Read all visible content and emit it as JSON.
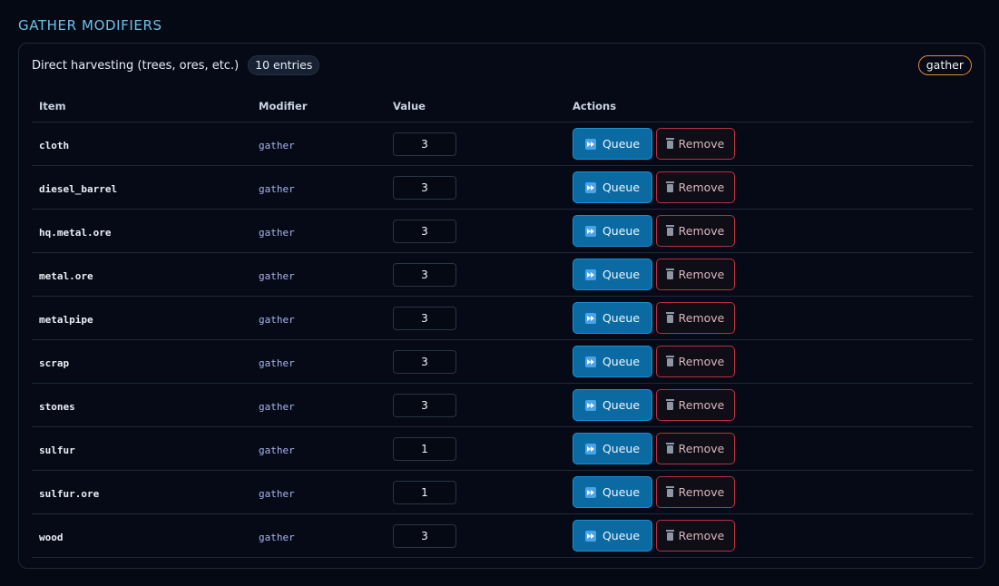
{
  "section_title": "GATHER MODIFIERS",
  "panel": {
    "description": "Direct harvesting (trees, ores, etc.)",
    "count_label": "10 entries",
    "tag": "gather"
  },
  "table": {
    "headers": {
      "item": "Item",
      "modifier": "Modifier",
      "value": "Value",
      "actions": "Actions"
    },
    "queue_label": "Queue",
    "remove_label": "Remove",
    "rows": [
      {
        "item": "cloth",
        "modifier": "gather",
        "value": "3"
      },
      {
        "item": "diesel_barrel",
        "modifier": "gather",
        "value": "3"
      },
      {
        "item": "hq.metal.ore",
        "modifier": "gather",
        "value": "3"
      },
      {
        "item": "metal.ore",
        "modifier": "gather",
        "value": "3"
      },
      {
        "item": "metalpipe",
        "modifier": "gather",
        "value": "3"
      },
      {
        "item": "scrap",
        "modifier": "gather",
        "value": "3"
      },
      {
        "item": "stones",
        "modifier": "gather",
        "value": "3"
      },
      {
        "item": "sulfur",
        "modifier": "gather",
        "value": "1"
      },
      {
        "item": "sulfur.ore",
        "modifier": "gather",
        "value": "1"
      },
      {
        "item": "wood",
        "modifier": "gather",
        "value": "3"
      }
    ]
  },
  "icons": {
    "queue": "fast-forward-icon",
    "remove": "trash-icon"
  },
  "colors": {
    "accent": "#0b6aa2",
    "danger": "#b8303e",
    "tag_border": "#e38a3a",
    "title": "#6cc0e8"
  }
}
